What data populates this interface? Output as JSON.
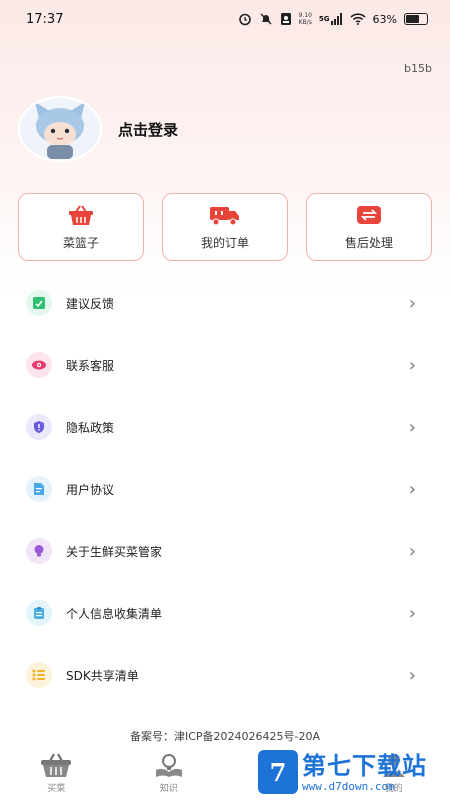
{
  "status_bar": {
    "time": "17:37",
    "net_speed_value": "9.10",
    "net_speed_unit": "KB/s",
    "signal_label": "5G",
    "battery": "63%",
    "battery_level": 0.63
  },
  "version": "b15b",
  "profile": {
    "login_label": "点击登录"
  },
  "quick_actions": [
    {
      "label": "菜篮子",
      "icon": "basket-icon"
    },
    {
      "label": "我的订单",
      "icon": "delivery-truck-icon"
    },
    {
      "label": "售后处理",
      "icon": "exchange-icon"
    }
  ],
  "menu": [
    {
      "label": "建议反馈",
      "icon": "feedback-icon",
      "color": "#2fbf71"
    },
    {
      "label": "联系客服",
      "icon": "eye-icon",
      "color": "#e63a6a"
    },
    {
      "label": "隐私政策",
      "icon": "shield-icon",
      "color": "#6a5ae0"
    },
    {
      "label": "用户协议",
      "icon": "document-icon",
      "color": "#4aa8e8"
    },
    {
      "label": "关于生鲜买菜管家",
      "icon": "lightbulb-icon",
      "color": "#9b59d6"
    },
    {
      "label": "个人信息收集清单",
      "icon": "clipboard-icon",
      "color": "#4ab0e0"
    },
    {
      "label": "SDK共享清单",
      "icon": "list-icon",
      "color": "#f0b429"
    }
  ],
  "icp": "备案号：津ICP备2024026425号-20A",
  "bottom_nav": [
    {
      "label": "买菜",
      "icon": "basket-nav-icon"
    },
    {
      "label": "知识",
      "icon": "lightbulb-book-icon"
    },
    {
      "label": "",
      "icon": "hidden-nav-icon"
    },
    {
      "label": "我的",
      "icon": "person-nav-icon"
    }
  ],
  "watermark": {
    "title": "第七下载站",
    "url": "www.d7down.com"
  }
}
